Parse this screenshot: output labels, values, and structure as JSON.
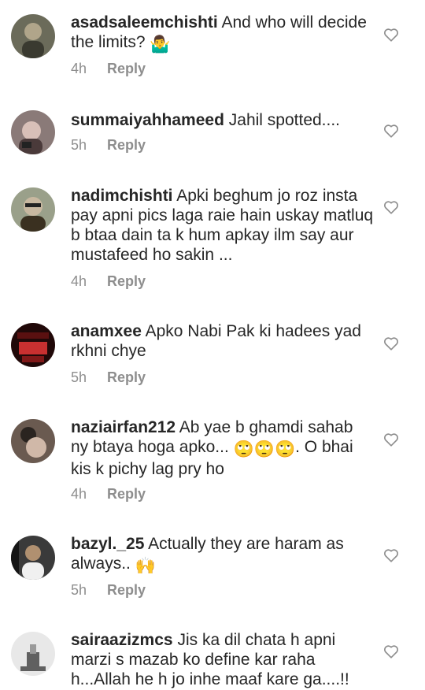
{
  "comments": [
    {
      "username": "asadsaleemchishti",
      "text": "And who will decide the limits?",
      "emoji": "🤷‍♂️",
      "time": "4h",
      "reply": "Reply",
      "avatar_colors": [
        "#6b6b5a",
        "#3a3a30",
        "#b0a58a"
      ]
    },
    {
      "username": "summaiyahhameed",
      "text": "Jahil spotted....",
      "time": "5h",
      "reply": "Reply",
      "avatar_colors": [
        "#8a7a78",
        "#4a3a3a",
        "#d8c0b8"
      ]
    },
    {
      "username": "nadimchishti",
      "text": "Apki beghum jo roz insta pay apni pics laga raie hain uskay matluq b btaa dain ta k hum apkay ilm say aur mustafeed ho sakin ...",
      "time": "4h",
      "reply": "Reply",
      "avatar_colors": [
        "#9aa08a",
        "#3a3020",
        "#c8b8a0"
      ]
    },
    {
      "username": "anamxee",
      "text": "Apko Nabi Pak ki hadees yad rkhni chye",
      "time": "5h",
      "reply": "Reply",
      "avatar_colors": [
        "#5a1010",
        "#200808",
        "#c83030"
      ]
    },
    {
      "username": "naziairfan212",
      "text": "Ab yae b ghamdi sahab ny btaya hoga apko...",
      "emoji": "🙄🙄🙄",
      "text2": ". O bhai kis k pichy lag pry ho",
      "time": "4h",
      "reply": "Reply",
      "avatar_colors": [
        "#6a5a50",
        "#2a2420",
        "#d0b8a8"
      ]
    },
    {
      "username": "bazyl._25",
      "text": "Actually they are haram as always..",
      "emoji": "🙌",
      "time": "5h",
      "reply": "Reply",
      "avatar_colors": [
        "#3a3a3a",
        "#151515",
        "#b09070"
      ]
    },
    {
      "username": "sairaazizmcs",
      "text": "Jis ka dil chata h apni marzi s mazab ko define kar raha h...Allah he h jo inhe maaf kare ga....!!",
      "time": "",
      "reply": "",
      "avatar_colors": [
        "#e8e8e8",
        "#9a9a9a",
        "#606060"
      ]
    }
  ]
}
